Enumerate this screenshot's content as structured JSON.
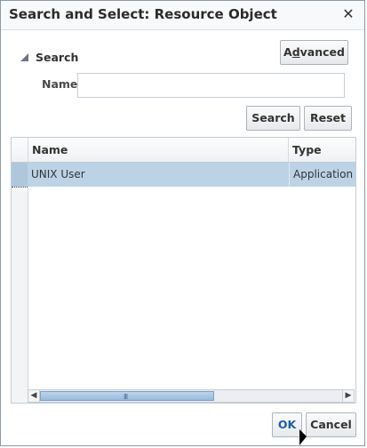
{
  "dialog": {
    "title": "Search and Select: Resource Object",
    "close_glyph": "✕"
  },
  "search": {
    "toggle_label": "Search",
    "advanced_prefix": "A",
    "advanced_mnemonic": "d",
    "advanced_suffix": "vanced",
    "name_label": "Name",
    "name_value": "",
    "search_button": "Search",
    "reset_button": "Reset"
  },
  "table": {
    "columns": [
      "Name",
      "Type"
    ],
    "rows": [
      {
        "name": "UNIX User",
        "type": "Application"
      }
    ],
    "scroll_grip": "III"
  },
  "footer": {
    "ok_button": "OK",
    "cancel_button": "Cancel"
  },
  "colors": {
    "selected_row": "#bcd3e6",
    "ok_text": "#1f5fa8"
  }
}
